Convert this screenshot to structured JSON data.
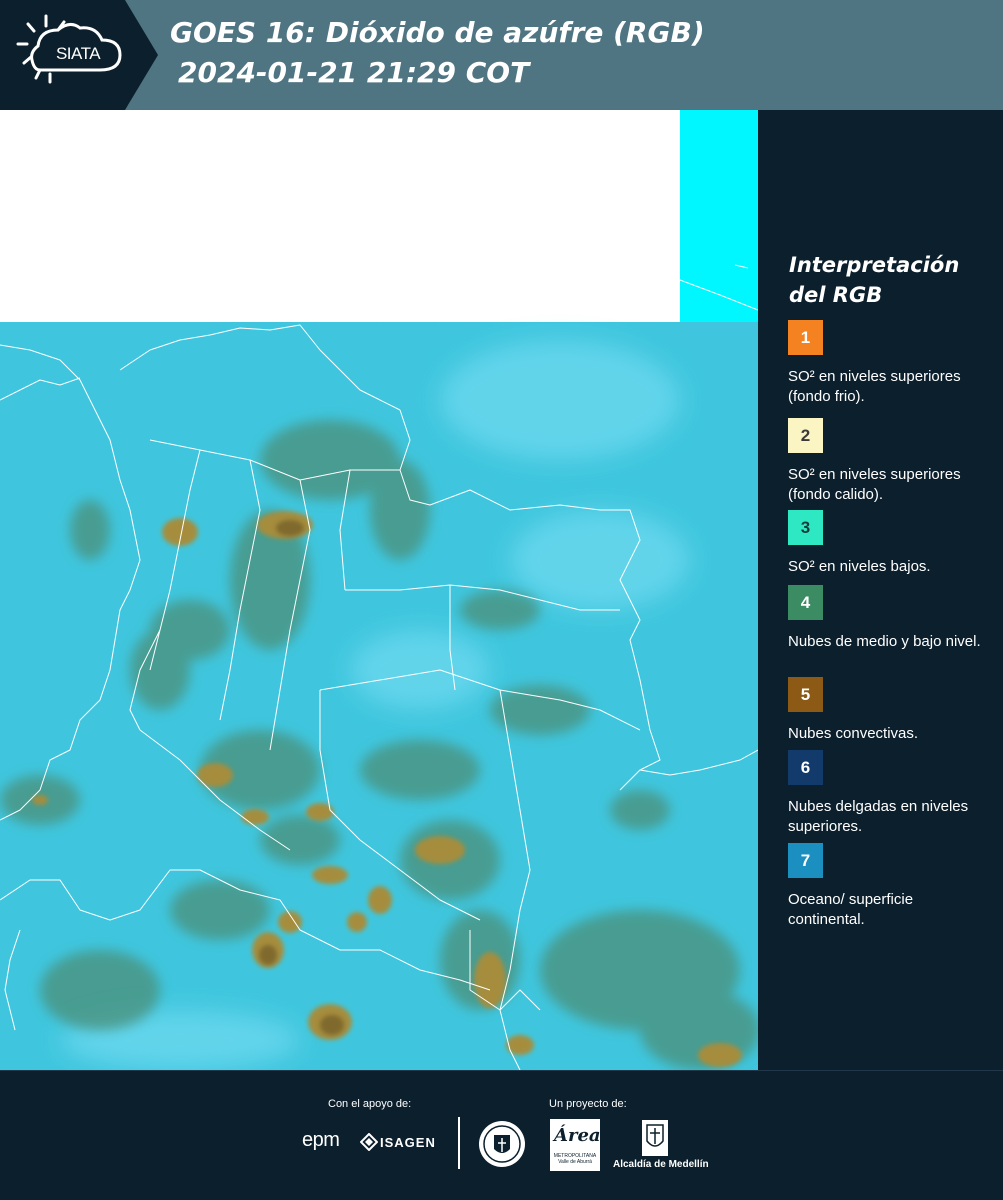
{
  "header": {
    "logo_text": "SIATA",
    "title_line1": "GOES 16: Dióxido de azúfre (RGB)",
    "title_line2": "2024-01-21 21:29 COT"
  },
  "legend": {
    "title": "Interpretación del RGB",
    "items": [
      {
        "number": "1",
        "color": "#f58220",
        "text_color": "#ffffff",
        "label": "SO² en niveles superiores (fondo frio)."
      },
      {
        "number": "2",
        "color": "#fbf5c4",
        "text_color": "#3a3a3a",
        "label": "SO² en niveles superiores (fondo calido)."
      },
      {
        "number": "3",
        "color": "#2ee8c4",
        "text_color": "#1a3a3a",
        "label": "SO² en niveles bajos."
      },
      {
        "number": "4",
        "color": "#3c8c63",
        "text_color": "#ffffff",
        "label": "Nubes de medio y bajo nivel."
      },
      {
        "number": "5",
        "color": "#8c5a14",
        "text_color": "#ffffff",
        "label": "Nubes convectivas."
      },
      {
        "number": "6",
        "color": "#123a6a",
        "text_color": "#ffffff",
        "label": "Nubes delgadas en niveles superiores."
      },
      {
        "number": "7",
        "color": "#1a8fc0",
        "text_color": "#ffffff",
        "label": "Oceano/ superficie continental."
      }
    ]
  },
  "footer": {
    "support_label": "Con el apoyo de:",
    "project_label": "Un proyecto de:",
    "epm": "epm",
    "isagen": "ISAGEN",
    "area_script": "Área",
    "area_sub": "METROPOLITANA Valle de Aburrá",
    "alcaldia": "Alcaldía de Medellín"
  },
  "map": {
    "colors": {
      "no_data": "#ffffff",
      "cyan_strip": "#00f7ff",
      "background": "#3fc6de",
      "light_patch": "#69d6ec",
      "green_cloud": "#4c8f78",
      "convective": "#a58d3c",
      "convective_dark": "#6f5a26",
      "borders": "#ffffff"
    }
  }
}
